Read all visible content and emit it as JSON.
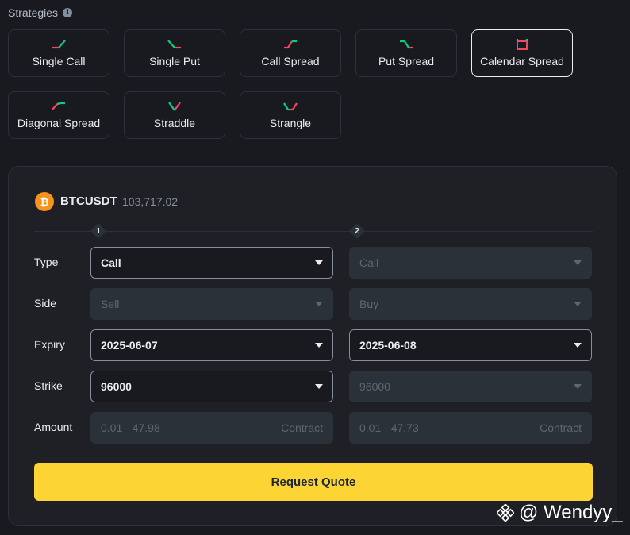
{
  "strategies": {
    "title": "Strategies",
    "items": [
      {
        "label": "Single Call",
        "icon": "single-call-icon"
      },
      {
        "label": "Single Put",
        "icon": "single-put-icon"
      },
      {
        "label": "Call Spread",
        "icon": "call-spread-icon"
      },
      {
        "label": "Put Spread",
        "icon": "put-spread-icon"
      },
      {
        "label": "Calendar Spread",
        "icon": "calendar-spread-icon",
        "active": true
      },
      {
        "label": "Diagonal Spread",
        "icon": "diagonal-spread-icon"
      },
      {
        "label": "Straddle",
        "icon": "straddle-icon"
      },
      {
        "label": "Strangle",
        "icon": "strangle-icon"
      }
    ]
  },
  "instrument": {
    "symbol": "BTCUSDT",
    "price": "103,717.02",
    "logo_letter": "₿"
  },
  "legs": [
    "1",
    "2"
  ],
  "rows": {
    "type": "Type",
    "side": "Side",
    "expiry": "Expiry",
    "strike": "Strike",
    "amount": "Amount"
  },
  "leg1": {
    "type": "Call",
    "side": "Sell",
    "expiry": "2025-06-07",
    "strike": "96000",
    "amount_placeholder": "0.01 - 47.98",
    "amount_unit": "Contract"
  },
  "leg2": {
    "type": "Call",
    "side": "Buy",
    "expiry": "2025-06-08",
    "strike": "96000",
    "amount_placeholder": "0.01 - 47.73",
    "amount_unit": "Contract"
  },
  "request_quote_label": "Request Quote",
  "watermark": "@ Wendyy_",
  "colors": {
    "accent": "#fcd535",
    "up": "#0ecb81",
    "down": "#f6465d"
  }
}
